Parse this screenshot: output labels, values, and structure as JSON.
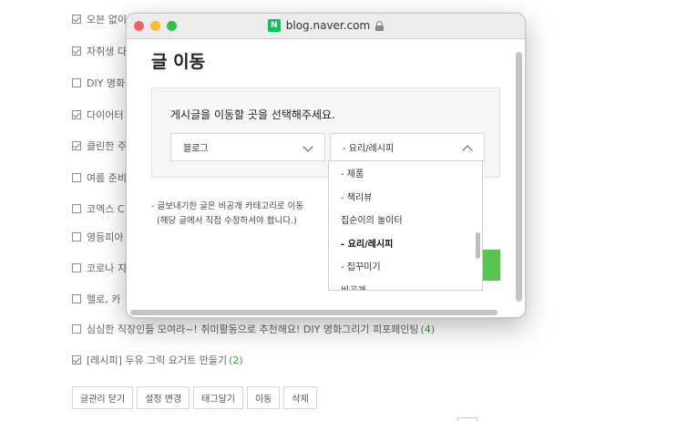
{
  "background": {
    "rows": [
      {
        "label": "오븐 없이",
        "checked": true,
        "count": ""
      },
      {
        "label": "자취생 다",
        "checked": true,
        "count": ""
      },
      {
        "label": "DIY 명화",
        "checked": false,
        "count": ""
      },
      {
        "label": "다이어터",
        "checked": true,
        "count": ""
      },
      {
        "label": "클린한 주",
        "checked": true,
        "count": ""
      },
      {
        "label": "여름 준비",
        "checked": false,
        "count": ""
      },
      {
        "label": "코엑스 C",
        "checked": false,
        "count": ""
      },
      {
        "label": "영등피아",
        "checked": false,
        "count": ""
      },
      {
        "label": "코로나 지",
        "checked": false,
        "count": ""
      },
      {
        "label": "헬로, 카",
        "checked": false,
        "count": ""
      },
      {
        "label": "심심한 직장인들 모여라~! 취미활동으로 추천해요! DIY 명화그리기 피포페인팅",
        "checked": false,
        "count": "(4)"
      },
      {
        "label": "[레시피] 두유 그릭 요거트 만들기",
        "checked": true,
        "count": "(2)"
      }
    ],
    "buttons": [
      "글관리 닫기",
      "설정 변경",
      "태그달기",
      "이동",
      "삭제"
    ]
  },
  "window": {
    "url": "blog.naver.com",
    "site_icon_letter": "N",
    "title": "글 이동",
    "instruction": "게시글을 이동할 곳을 선택해주세요.",
    "blog_select": "블로그",
    "category_select": "- 요리/레시피",
    "note_line1": "- 글보내기한 글은 비공개 카테고리로 이동",
    "note_line2": "(해당 글에서 직접 수정하셔야 합니다.)",
    "dropdown_options": [
      {
        "label": "- 제품",
        "selected": false
      },
      {
        "label": "- 책리뷰",
        "selected": false
      },
      {
        "label": "집순이의 놀이터",
        "selected": false
      },
      {
        "label": "- 요리/레시피",
        "selected": true
      },
      {
        "label": "- 집꾸미기",
        "selected": false
      },
      {
        "label": "비공개",
        "selected": false
      }
    ],
    "colors": {
      "accent_green": "#59c452",
      "naver_green": "#03c75a"
    }
  }
}
